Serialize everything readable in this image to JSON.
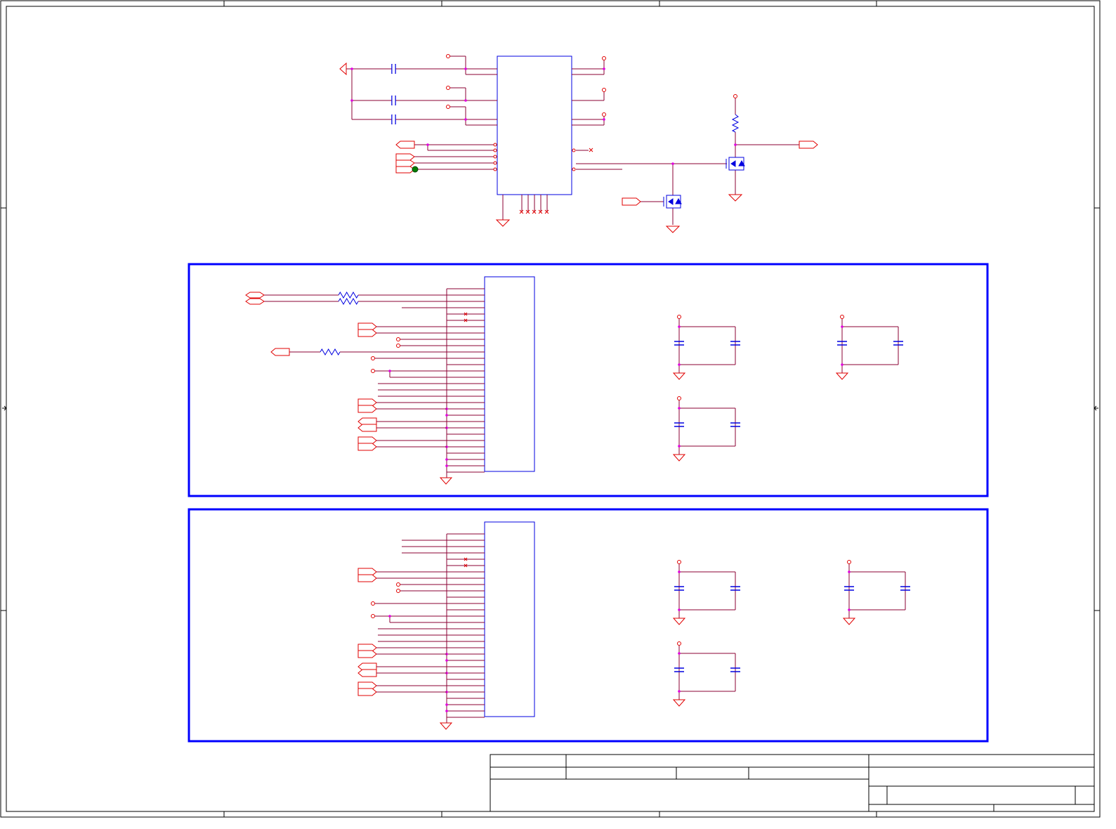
{
  "sheet": {
    "type": "electrical schematic",
    "text_labels": [],
    "title_block": {
      "fields": []
    }
  },
  "colors": {
    "background": "#ffffff",
    "border": "#000000",
    "wire": "#8b0033",
    "symbol": "#e00000",
    "component": "#0000e0",
    "block_frame": "#0000ff",
    "junction": "#e000e0",
    "probe_marker": "#008000"
  },
  "blocks": [
    {
      "name": "lcd-interface-block-1",
      "connector_pins": 30
    },
    {
      "name": "lcd-interface-block-2",
      "connector_pins": 30
    }
  ]
}
